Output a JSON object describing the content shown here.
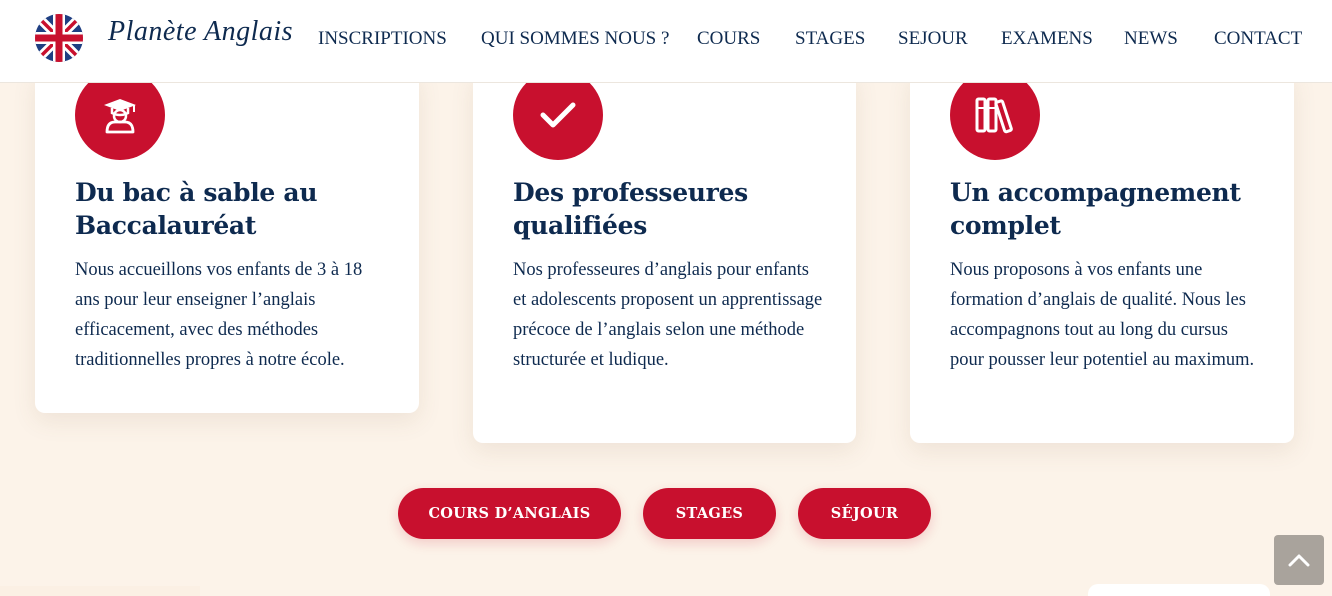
{
  "header": {
    "logo_text": "Planète Anglais",
    "nav": [
      {
        "label": "INSCRIPTIONS"
      },
      {
        "label": "QUI SOMMES NOUS ?"
      },
      {
        "label": "COURS"
      },
      {
        "label": "STAGES"
      },
      {
        "label": "SEJOUR"
      },
      {
        "label": "EXAMENS"
      },
      {
        "label": "NEWS"
      },
      {
        "label": "CONTACT"
      }
    ]
  },
  "cards": [
    {
      "icon": "graduate-icon",
      "title": "Du bac à sable au Baccalauréat",
      "text": "Nous accueillons vos enfants de 3 à 18 ans pour leur enseigner l’anglais efficacement, avec des méthodes traditionnelles propres à notre école."
    },
    {
      "icon": "checkmark-icon",
      "title": "Des professeures qualifiées",
      "text": "Nos professeures d’anglais pour enfants et adolescents proposent un apprentissage précoce de l’anglais selon une méthode structurée et ludique."
    },
    {
      "icon": "books-icon",
      "title": "Un accompagnement complet",
      "text": "Nous proposons à vos enfants une formation d’anglais de qualité. Nous les accompagnons tout au long du cursus pour pousser leur potentiel au maximum."
    }
  ],
  "buttons": {
    "courses": "COURS D’ANGLAIS",
    "stages": "STAGES",
    "sejour": "SÉJOUR"
  },
  "colors": {
    "accent": "#c8102e",
    "navy": "#0e2a4f",
    "background": "#fcf3e9"
  }
}
